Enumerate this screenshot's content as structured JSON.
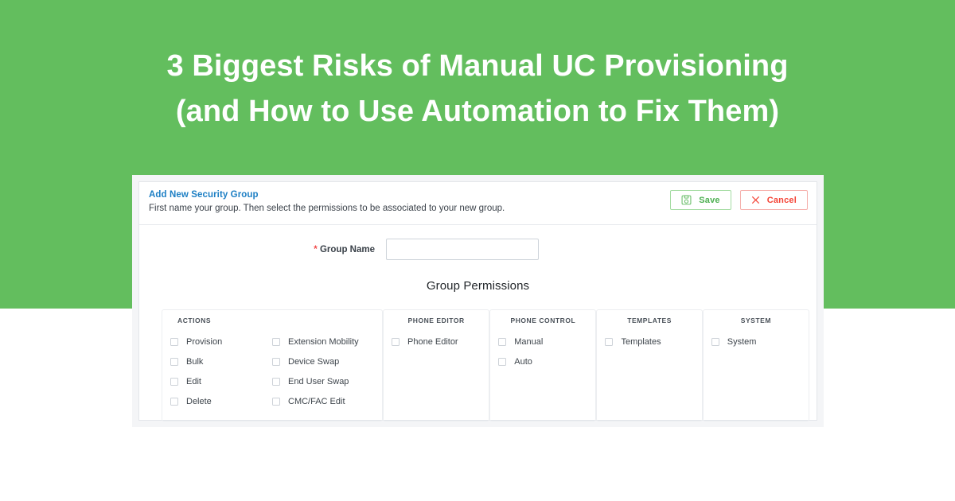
{
  "banner": {
    "background_color": "#63be5e",
    "headline_lines": [
      "3 Biggest Risks of Manual UC Provisioning",
      "(and How to Use Automation to Fix Them)"
    ],
    "text_color": "#ffffff"
  },
  "app": {
    "header": {
      "title": "Add New Security Group",
      "title_color": "#1d7fc4",
      "subtitle": "First name your group. Then select the permissions to be associated to your new group.",
      "save_label": "Save",
      "save_icon": "floppy-disk-save-icon",
      "save_color": "#4caf50",
      "cancel_label": "Cancel",
      "cancel_icon": "close-x-icon",
      "cancel_color": "#f44336"
    },
    "form": {
      "required_marker": "*",
      "group_name_label": "Group Name",
      "group_name_value": "",
      "group_name_placeholder": ""
    },
    "permissions": {
      "title": "Group Permissions",
      "groups": [
        {
          "heading": "ACTIONS",
          "column_a": [
            {
              "label": "Provision",
              "checked": false
            },
            {
              "label": "Bulk",
              "checked": false
            },
            {
              "label": "Edit",
              "checked": false
            },
            {
              "label": "Delete",
              "checked": false
            }
          ],
          "column_b": [
            {
              "label": "Extension Mobility",
              "checked": false
            },
            {
              "label": "Device Swap",
              "checked": false
            },
            {
              "label": "End User Swap",
              "checked": false
            },
            {
              "label": "CMC/FAC Edit",
              "checked": false
            }
          ]
        },
        {
          "heading": "PHONE EDITOR",
          "items": [
            {
              "label": "Phone Editor",
              "checked": false
            }
          ]
        },
        {
          "heading": "PHONE CONTROL",
          "items": [
            {
              "label": "Manual",
              "checked": false
            },
            {
              "label": "Auto",
              "checked": false
            }
          ]
        },
        {
          "heading": "TEMPLATES",
          "items": [
            {
              "label": "Templates",
              "checked": false
            }
          ]
        },
        {
          "heading": "SYSTEM",
          "items": [
            {
              "label": "System",
              "checked": false
            }
          ]
        }
      ]
    }
  }
}
